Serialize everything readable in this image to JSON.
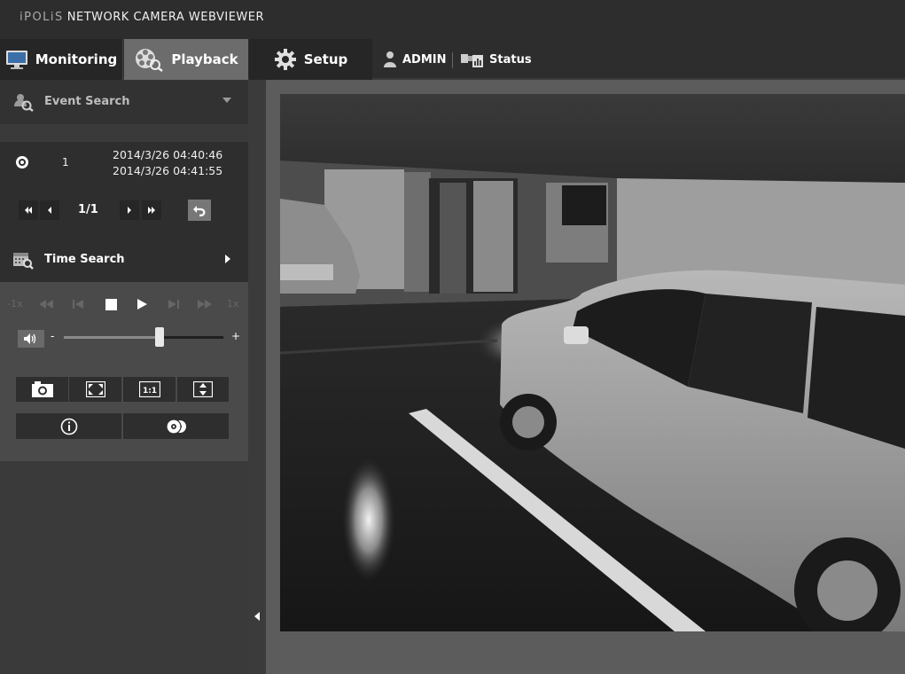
{
  "header": {
    "brand_prefix": "iPOLiS",
    "title": "NETWORK CAMERA WEBVIEWER"
  },
  "nav": {
    "tabs": [
      {
        "label": "Monitoring",
        "icon": "monitor-icon"
      },
      {
        "label": "Playback",
        "icon": "film-reel-icon",
        "active": true
      },
      {
        "label": "Setup",
        "icon": "gear-icon"
      }
    ],
    "user_label": "ADMIN",
    "status_label": "Status"
  },
  "sidebar": {
    "event_search": {
      "label": "Event Search",
      "expanded": true
    },
    "event_list": [
      {
        "index": "1",
        "start": "2014/3/26 04:40:46",
        "end": "2014/3/26 04:41:55",
        "selected": true
      }
    ],
    "pager": {
      "page": "1/1"
    },
    "time_search": {
      "label": "Time Search",
      "expanded": false
    },
    "playback": {
      "speed_slow": "-1x",
      "speed_fast": "1x",
      "volume_min": "-",
      "volume_max": "+",
      "volume_level": 0.6
    },
    "tools": {
      "ratio_label": "1:1"
    }
  },
  "colors": {
    "background": "#2b2b2b",
    "active_tab": "#6c6c6c",
    "sidebar": "#3a3a3a",
    "controls": "#4a4a4a",
    "video_frame": "#5c5c5c"
  }
}
